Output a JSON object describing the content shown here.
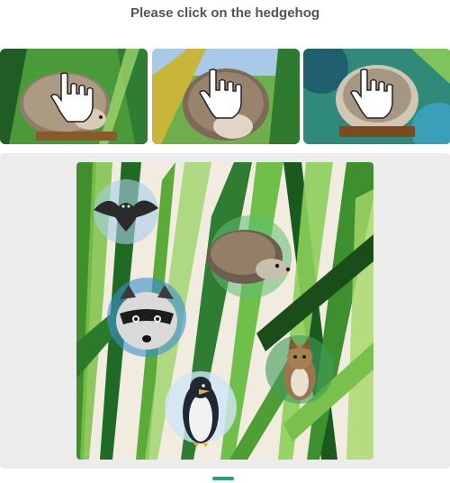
{
  "prompt": {
    "text": "Please click on the hedgehog"
  },
  "examples": [
    {
      "icon": "hedgehog-example-icon",
      "overlay": "pointer-hand-icon"
    },
    {
      "icon": "hedgehog-example-icon",
      "overlay": "pointer-hand-icon"
    },
    {
      "icon": "hedgehog-example-icon",
      "overlay": "pointer-hand-icon"
    }
  ],
  "puzzle": {
    "background": "watercolor-grass",
    "animals": [
      "bat",
      "hedgehog",
      "raccoon",
      "cat",
      "penguin"
    ]
  },
  "colors": {
    "prompt_text": "#555555",
    "panel_bg": "#ececec",
    "grass_dark": "#1f6b1f",
    "grass_light": "#8fcf4a",
    "footer_accent": "#21a67a"
  }
}
